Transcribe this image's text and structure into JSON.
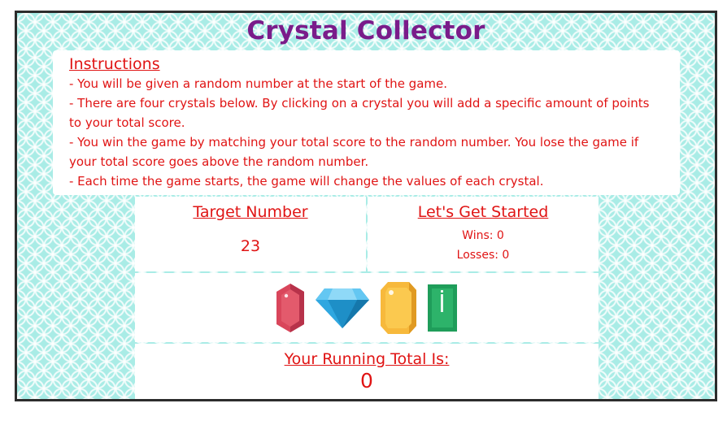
{
  "title": "Crystal Collector",
  "instructions": {
    "heading": "Instructions",
    "lines": [
      "- You will be given a random number at the start of the game.",
      "- There are four crystals below. By clicking on a crystal you will add a specific amount of points to your total score.",
      "- You win the game by matching your total score to the random number. You lose the game if your total score goes above the random number.",
      "- Each time the game starts, the game will change the values of each crystal."
    ]
  },
  "target": {
    "heading": "Target Number",
    "value": "23"
  },
  "status": {
    "heading": "Let's Get Started",
    "wins": "Wins: 0",
    "losses": "Losses: 0"
  },
  "crystals": [
    {
      "icon": "red-crystal-icon",
      "color": "#d9465b"
    },
    {
      "icon": "blue-diamond-icon",
      "color": "#2fa7e0"
    },
    {
      "icon": "yellow-crystal-icon",
      "color": "#f7b93c"
    },
    {
      "icon": "green-crystal-icon",
      "color": "#1f9d5a"
    }
  ],
  "total": {
    "heading": "Your Running Total Is:",
    "value": "0"
  },
  "colors": {
    "title": "#7a1c8a",
    "text": "#e01414",
    "background": "#a9ece6"
  }
}
